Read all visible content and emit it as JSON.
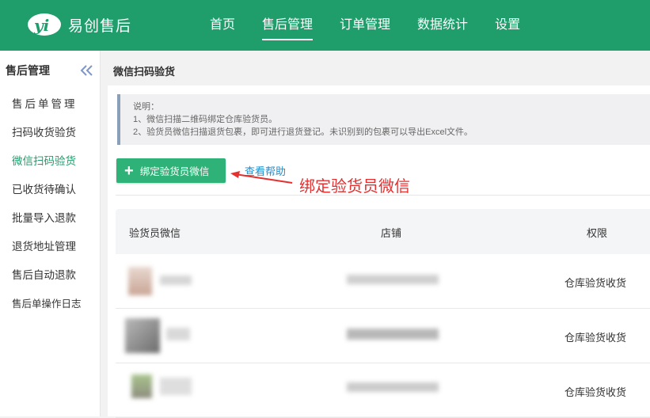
{
  "app": {
    "name": "易创售后"
  },
  "nav": [
    {
      "label": "首页",
      "active": false
    },
    {
      "label": "售后管理",
      "active": true
    },
    {
      "label": "订单管理",
      "active": false
    },
    {
      "label": "数据统计",
      "active": false
    },
    {
      "label": "设置",
      "active": false
    }
  ],
  "sidebar": {
    "title": "售后管理",
    "items": [
      {
        "label": "售后单管理"
      },
      {
        "label": "扫码收货验货"
      },
      {
        "label": "微信扫码验货"
      },
      {
        "label": "已收货待确认"
      },
      {
        "label": "批量导入退款"
      },
      {
        "label": "退货地址管理"
      },
      {
        "label": "售后自动退款"
      },
      {
        "label": "售后单操作日志"
      }
    ]
  },
  "page": {
    "title": "微信扫码验货",
    "note": {
      "heading": "说明：",
      "line1": "1、微信扫描二维码绑定仓库验货员。",
      "line2": "2、验货员微信扫描退货包裹，即可进行退货登记。未识别到的包裹可以导出Excel文件。"
    },
    "bind_button": "绑定验货员微信",
    "help_link": "查看帮助",
    "annotation": "绑定验货员微信"
  },
  "table": {
    "columns": [
      "验货员微信",
      "店铺",
      "权限"
    ],
    "rows": [
      {
        "permission": "仓库验货收货"
      },
      {
        "permission": "仓库验货收货"
      },
      {
        "permission": "仓库验货收货"
      }
    ]
  },
  "colors": {
    "brand": "#1f9d6b",
    "button": "#2fb277",
    "link": "#1e8fd0",
    "annotation": "#e53030"
  }
}
